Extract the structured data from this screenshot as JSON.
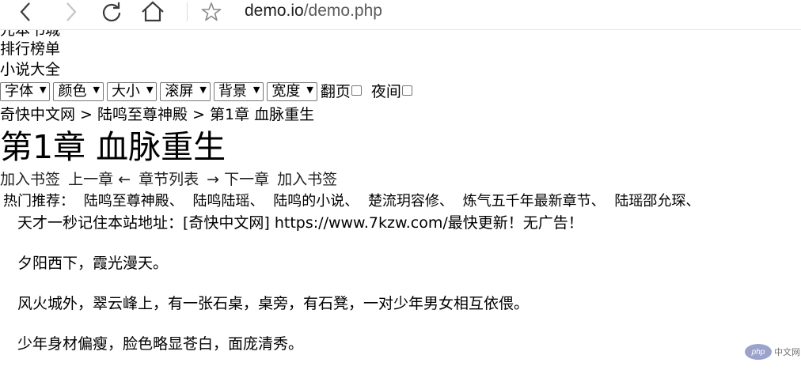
{
  "browser": {
    "url_host": "demo.io",
    "url_path": "/demo.php"
  },
  "nav": {
    "partial_link": "元本书城",
    "rank_link": "排行榜单",
    "all_novels_link": "小说大全"
  },
  "toolbar": {
    "font_label": "字体",
    "color_label": "颜色",
    "size_label": "大小",
    "scroll_label": "滚屏",
    "background_label": "背景",
    "width_label": "宽度",
    "page_turn_label": "翻页",
    "night_label": "夜间"
  },
  "breadcrumb": {
    "site": "奇快中文网",
    "sep1": " > ",
    "book": "陆鸣至尊神殿",
    "sep2": " > ",
    "chapter": "第1章 血脉重生"
  },
  "chapter": {
    "title": "第1章 血脉重生"
  },
  "chapter_nav": {
    "bookmark_left": "加入书签",
    "prev": "上一章 ←",
    "list": "章节列表",
    "next": "→ 下一章",
    "bookmark_right": "加入书签"
  },
  "recommend": {
    "label": "热门推荐：",
    "items": [
      "陆鸣至尊神殿、",
      "陆鸣陆瑶、",
      "陆鸣的小说、",
      "楚流玥容修、",
      "炼气五千年最新章节、",
      "陆瑶邵允琛、"
    ]
  },
  "content": {
    "paragraphs": [
      "天才一秒记住本站地址：[奇快中文网] https://www.7kzw.com/最快更新！无广告！",
      "夕阳西下，霞光漫天。",
      "风火城外，翠云峰上，有一张石桌，桌旁，有石凳，一对少年男女相互依偎。",
      "少年身材偏瘦，脸色略显苍白，面庞清秀。"
    ]
  },
  "watermark": {
    "logo_text": "php",
    "site_text": "中文网"
  },
  "icons": {
    "back": "back-arrow-icon",
    "forward": "forward-arrow-icon",
    "reload": "reload-icon",
    "home": "home-icon",
    "bookmark": "star-icon"
  }
}
